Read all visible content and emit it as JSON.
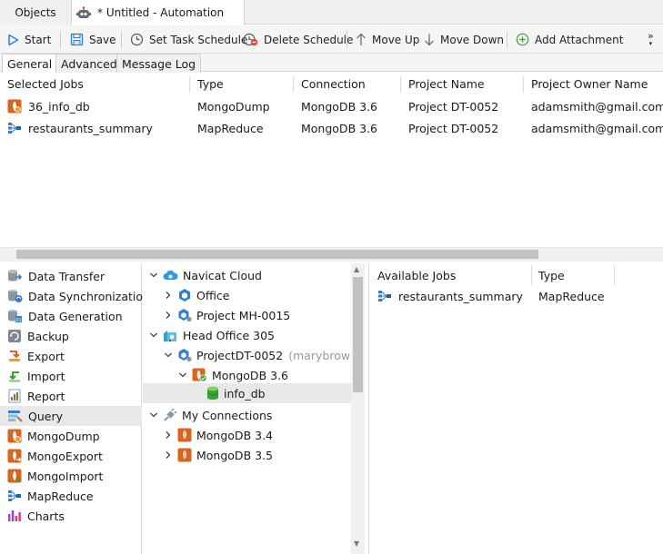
{
  "tabs": {
    "objects_label": "Objects",
    "active_label": "* Untitled - Automation"
  },
  "toolbar": {
    "start": "Start",
    "save": "Save",
    "set_schedule": "Set Task Schedule",
    "delete_schedule": "Delete Schedule",
    "move_up": "Move Up",
    "move_down": "Move Down",
    "add_attachment": "Add Attachment",
    "overflow": "»"
  },
  "subtabs": [
    "General",
    "Advanced",
    "Message Log"
  ],
  "jobs": {
    "columns": [
      "Selected Jobs",
      "Type",
      "Connection",
      "Project Name",
      "Project Owner Name"
    ],
    "rows": [
      {
        "name": "36_info_db",
        "icon": "mongodump-icon",
        "type": "MongoDump",
        "connection": "MongoDB 3.6",
        "project": "Project DT-0052",
        "owner": "adamsmith@gmail.com"
      },
      {
        "name": "restaurants_summary",
        "icon": "mapreduce-icon",
        "type": "MapReduce",
        "connection": "MongoDB 3.6",
        "project": "Project DT-0052",
        "owner": "adamsmith@gmail.com"
      }
    ]
  },
  "object_types": [
    {
      "label": "Data Transfer",
      "icon": "data-transfer-icon"
    },
    {
      "label": "Data Synchronization",
      "icon": "data-sync-icon"
    },
    {
      "label": "Data Generation",
      "icon": "data-generation-icon"
    },
    {
      "label": "Backup",
      "icon": "backup-icon"
    },
    {
      "label": "Export",
      "icon": "export-icon"
    },
    {
      "label": "Import",
      "icon": "import-icon"
    },
    {
      "label": "Report",
      "icon": "report-icon"
    },
    {
      "label": "Query",
      "icon": "query-icon",
      "selected": true
    },
    {
      "label": "MongoDump",
      "icon": "mongodump-icon"
    },
    {
      "label": "MongoExport",
      "icon": "mongoexport-icon"
    },
    {
      "label": "MongoImport",
      "icon": "mongoimport-icon"
    },
    {
      "label": "MapReduce",
      "icon": "mapreduce-icon"
    },
    {
      "label": "Charts",
      "icon": "charts-icon"
    }
  ],
  "tree": {
    "navicat_cloud": "Navicat Cloud",
    "office": "Office",
    "project_mh": "Project MH-0015",
    "head_office": "Head Office 305",
    "project_dt": "ProjectDT-0052",
    "project_dt_owner": "(marybrown@",
    "mongodb36": "MongoDB 3.6",
    "info_db": "info_db",
    "my_connections": "My Connections",
    "mongodb34": "MongoDB 3.4",
    "mongodb35": "MongoDB 3.5"
  },
  "available": {
    "columns": [
      "Available Jobs",
      "Type"
    ],
    "rows": [
      {
        "name": "restaurants_summary",
        "icon": "mapreduce-icon",
        "type": "MapReduce"
      }
    ]
  },
  "colors": {
    "accent_blue": "#2f7fd3",
    "mongo_orange": "#d9641e",
    "mongo_green": "#3aa035",
    "selection": "#e8e8e8"
  }
}
